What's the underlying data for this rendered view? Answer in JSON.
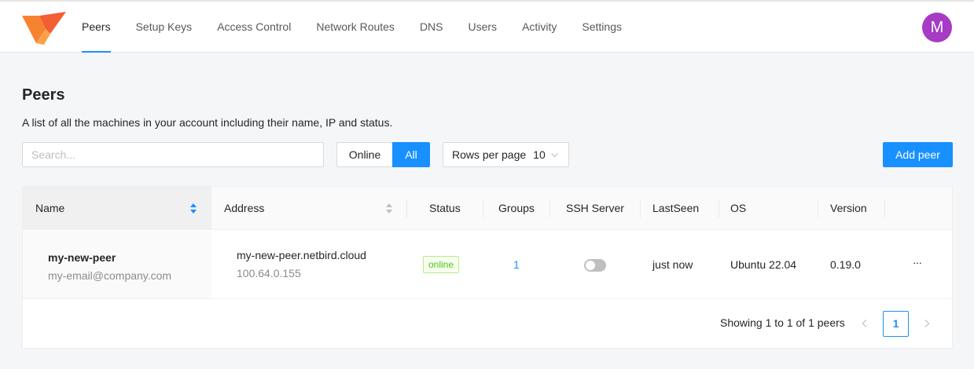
{
  "header": {
    "nav": [
      "Peers",
      "Setup Keys",
      "Access Control",
      "Network Routes",
      "DNS",
      "Users",
      "Activity",
      "Settings"
    ],
    "avatar_initial": "M",
    "avatar_color": "#a63bc4",
    "accent_color": "#1890ff"
  },
  "page": {
    "title": "Peers",
    "description": "A list of all the machines in your account including their name, IP and status."
  },
  "toolbar": {
    "search_placeholder": "Search...",
    "filter_online": "Online",
    "filter_all": "All",
    "filter_selected": "All",
    "rows_label": "Rows per page",
    "rows_value": "10",
    "add_peer": "Add peer"
  },
  "table": {
    "columns": [
      "Name",
      "Address",
      "Status",
      "Groups",
      "SSH Server",
      "LastSeen",
      "OS",
      "Version"
    ],
    "rows": [
      {
        "name": "my-new-peer",
        "email": "my-email@company.com",
        "address": "my-new-peer.netbird.cloud",
        "ip": "100.64.0.155",
        "status": "online",
        "groups": "1",
        "ssh_enabled": false,
        "last_seen": "just now",
        "os": "Ubuntu 22.04",
        "version": "0.19.0",
        "actions": "···"
      }
    ]
  },
  "pagination": {
    "summary": "Showing 1 to 1 of 1 peers",
    "current_page": "1"
  }
}
